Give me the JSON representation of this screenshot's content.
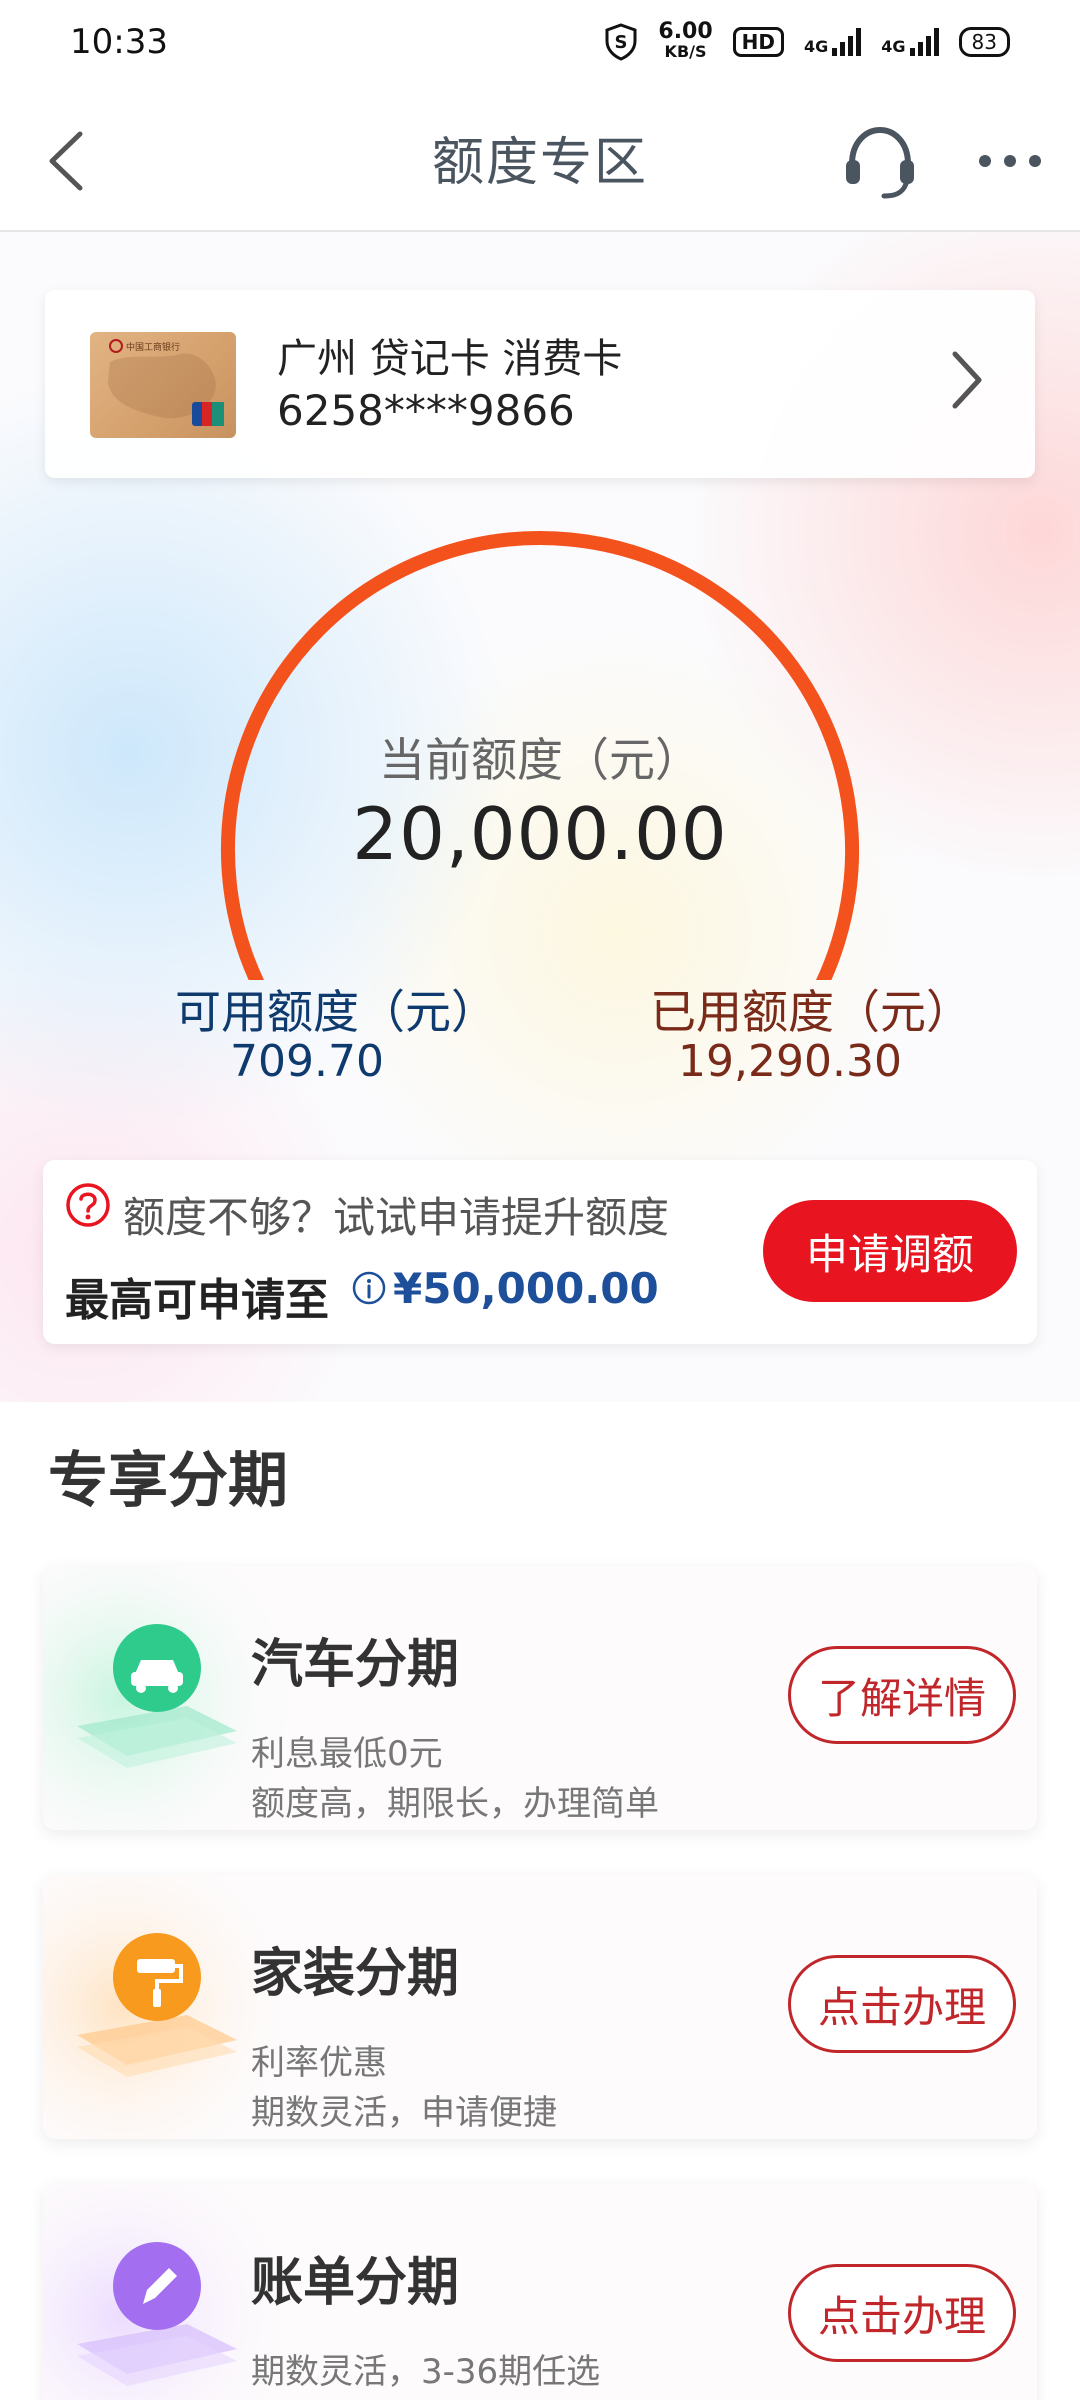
{
  "status_bar": {
    "time": "10:33",
    "net_speed": "6.00",
    "net_unit": "KB/S",
    "hd": "HD",
    "signal1": "4G",
    "signal2": "4G",
    "battery": "83"
  },
  "nav": {
    "title": "额度专区",
    "back_icon": "chevron-left-icon",
    "service_icon": "headset-icon",
    "more_icon": "more-dots-icon"
  },
  "card": {
    "name": "广州 贷记卡 消费卡",
    "number": "6258****9866",
    "card_face_text": "中国工商银行"
  },
  "quota": {
    "total_label": "当前额度（元）",
    "total_value": "20,000.00",
    "available_label": "可用额度（元）",
    "available_value": "709.70",
    "used_label": "已用额度（元）",
    "used_value": "19,290.30",
    "available_fraction": 0.0355,
    "colors": {
      "used_arc": "#f4521c",
      "available_arc": "#5ba2ee"
    }
  },
  "increase": {
    "prompt": "额度不够？试试申请提升额度",
    "max_label": "最高可申请至",
    "max_amount": "¥50,000.00",
    "button": "申请调额",
    "accent": "#e8141f"
  },
  "section": {
    "title": "专享分期",
    "items": [
      {
        "title": "汽车分期",
        "line1": "利息最低0元",
        "line2": "额度高，期限长，办理简单",
        "button": "了解详情",
        "icon": "car-icon",
        "color": "#2ecb8c"
      },
      {
        "title": "家装分期",
        "line1": "利率优惠",
        "line2": "期数灵活，申请便捷",
        "button": "点击办理",
        "icon": "paint-roller-icon",
        "color": "#f79a1e"
      },
      {
        "title": "账单分期",
        "line1": "期数灵活，3-36期任选",
        "line2": "",
        "button": "点击办理",
        "icon": "pencil-icon",
        "color": "#a36ff0"
      }
    ]
  }
}
